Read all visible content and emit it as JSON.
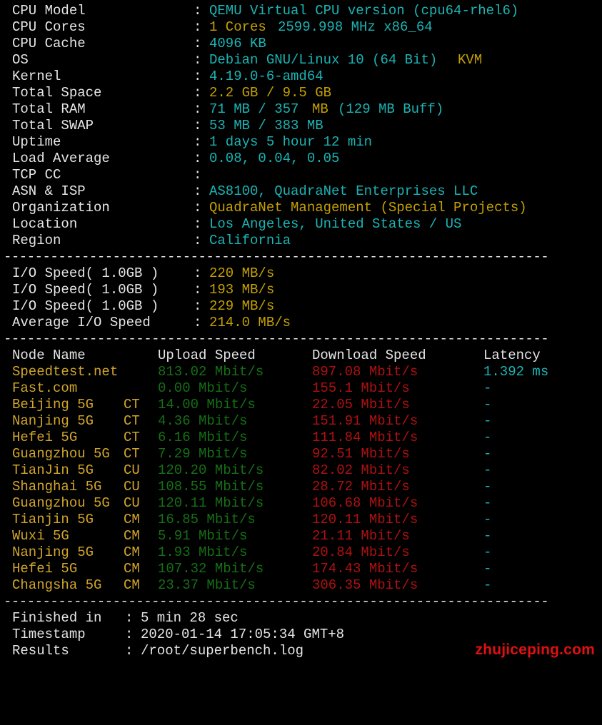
{
  "colors": {
    "background": "#000000",
    "label": "#e6e6e6",
    "cyan": "#1bb4b4",
    "yellow": "#c4a000",
    "green": "#157015",
    "red": "#b01010",
    "watermark": "#e01010"
  },
  "sysinfo": [
    {
      "label": "CPU Model",
      "sep": ":",
      "value": "QEMU Virtual CPU version (cpu64-rhel6)",
      "extra": ""
    },
    {
      "label": "CPU Cores",
      "sep": ":",
      "value": "1 Cores",
      "extra": "2599.998 MHz x86_64"
    },
    {
      "label": "CPU Cache",
      "sep": ":",
      "value": "4096 KB",
      "extra": ""
    },
    {
      "label": "OS",
      "sep": ":",
      "value": "Debian GNU/Linux 10 (64 Bit)",
      "extra": "KVM"
    },
    {
      "label": "Kernel",
      "sep": ":",
      "value": "4.19.0-6-amd64",
      "extra": ""
    },
    {
      "label": "Total Space",
      "sep": ":",
      "value": "2.2 GB / 9.5 GB",
      "extra": ""
    },
    {
      "label": "Total RAM",
      "sep": ":",
      "value": "71 MB / 357",
      "extra": "MB",
      "extra2": "(129 MB Buff)"
    },
    {
      "label": "Total SWAP",
      "sep": ":",
      "value": "53 MB / 383 MB",
      "extra": ""
    },
    {
      "label": "Uptime",
      "sep": ":",
      "value": "1 days 5 hour 12 min",
      "extra": ""
    },
    {
      "label": "Load Average",
      "sep": ":",
      "value": "0.08, 0.04, 0.05",
      "extra": ""
    },
    {
      "label": "TCP CC",
      "sep": ":",
      "value": "",
      "extra": ""
    },
    {
      "label": "ASN & ISP",
      "sep": ":",
      "value": "AS8100, QuadraNet Enterprises LLC",
      "extra": ""
    },
    {
      "label": "Organization",
      "sep": ":",
      "value": "QuadraNet Management (Special Projects)",
      "extra": ""
    },
    {
      "label": "Location",
      "sep": ":",
      "value": "Los Angeles, United States / US",
      "extra": ""
    },
    {
      "label": "Region",
      "sep": ":",
      "value": "California",
      "extra": ""
    }
  ],
  "separator": "----------------------------------------------------------------------",
  "io": [
    {
      "label": "I/O Speed( 1.0GB )",
      "sep": ":",
      "value": "220 MB/s"
    },
    {
      "label": "I/O Speed( 1.0GB )",
      "sep": ":",
      "value": "193 MB/s"
    },
    {
      "label": "I/O Speed( 1.0GB )",
      "sep": ":",
      "value": "229 MB/s"
    },
    {
      "label": "Average I/O Speed",
      "sep": ":",
      "value": "214.0 MB/s"
    }
  ],
  "speed_header": {
    "node": "Node Name",
    "upload": "Upload Speed",
    "download": "Download Speed",
    "latency": "Latency"
  },
  "speed_rows": [
    {
      "node": "Speedtest.net",
      "isp": "",
      "upload": "813.02 Mbit/s",
      "download": "897.08 Mbit/s",
      "latency": "1.392 ms"
    },
    {
      "node": "Fast.com",
      "isp": "",
      "upload": "0.00 Mbit/s",
      "download": "155.1 Mbit/s",
      "latency": "-"
    },
    {
      "node": "Beijing 5G",
      "isp": "CT",
      "upload": "14.00 Mbit/s",
      "download": "22.05 Mbit/s",
      "latency": "-"
    },
    {
      "node": "Nanjing 5G",
      "isp": "CT",
      "upload": "4.36 Mbit/s",
      "download": "151.91 Mbit/s",
      "latency": "-"
    },
    {
      "node": "Hefei 5G",
      "isp": "CT",
      "upload": "6.16 Mbit/s",
      "download": "111.84 Mbit/s",
      "latency": "-"
    },
    {
      "node": "Guangzhou 5G",
      "isp": "CT",
      "upload": "7.29 Mbit/s",
      "download": "92.51 Mbit/s",
      "latency": "-"
    },
    {
      "node": "TianJin 5G",
      "isp": "CU",
      "upload": "120.20 Mbit/s",
      "download": "82.02 Mbit/s",
      "latency": "-"
    },
    {
      "node": "Shanghai 5G",
      "isp": "CU",
      "upload": "108.55 Mbit/s",
      "download": "28.72 Mbit/s",
      "latency": "-"
    },
    {
      "node": "Guangzhou 5G",
      "isp": "CU",
      "upload": "120.11 Mbit/s",
      "download": "106.68 Mbit/s",
      "latency": "-"
    },
    {
      "node": "Tianjin 5G",
      "isp": "CM",
      "upload": "16.85 Mbit/s",
      "download": "120.11 Mbit/s",
      "latency": "-"
    },
    {
      "node": "Wuxi 5G",
      "isp": "CM",
      "upload": "5.91 Mbit/s",
      "download": "21.11 Mbit/s",
      "latency": "-"
    },
    {
      "node": "Nanjing 5G",
      "isp": "CM",
      "upload": "1.93 Mbit/s",
      "download": "20.84 Mbit/s",
      "latency": "-"
    },
    {
      "node": "Hefei 5G",
      "isp": "CM",
      "upload": "107.32 Mbit/s",
      "download": "174.43 Mbit/s",
      "latency": "-"
    },
    {
      "node": "Changsha 5G",
      "isp": "CM",
      "upload": "23.37 Mbit/s",
      "download": "306.35 Mbit/s",
      "latency": "-"
    }
  ],
  "footer": [
    {
      "label": "Finished in",
      "sep": ":",
      "value": "5 min 28 sec"
    },
    {
      "label": "Timestamp",
      "sep": ":",
      "value": "2020-01-14 17:05:34 GMT+8"
    },
    {
      "label": "Results",
      "sep": ":",
      "value": "/root/superbench.log"
    }
  ],
  "watermark": "zhujiceping.com"
}
